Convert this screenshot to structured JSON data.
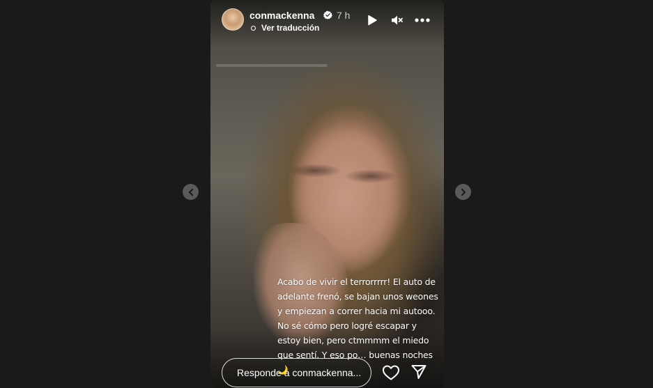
{
  "story": {
    "username": "conmackenna",
    "time": "7 h",
    "translate_label": "Ver traducción",
    "caption": "Acabo de vivir el terrorrrrr! El auto de adelante frenó, se bajan unos weones y empiezan a correr hacia mi autooo. No sé cómo pero logré escapar y estoy bien, pero ctmmmm el miedo que sentí. Y eso po… buenas noches 🌙",
    "reply_placeholder": "Responde a conmackenna..."
  },
  "icons": {
    "verified": "verified-badge-icon",
    "play": "play-icon",
    "mute": "speaker-muted-icon",
    "more": "more-options-icon",
    "heart": "heart-icon",
    "send": "send-icon",
    "prev": "chevron-left-icon",
    "next": "chevron-right-icon"
  },
  "colors": {
    "page_background": "#1a1a1a",
    "nav_button": "#5a5a5a",
    "text": "#ffffff"
  }
}
